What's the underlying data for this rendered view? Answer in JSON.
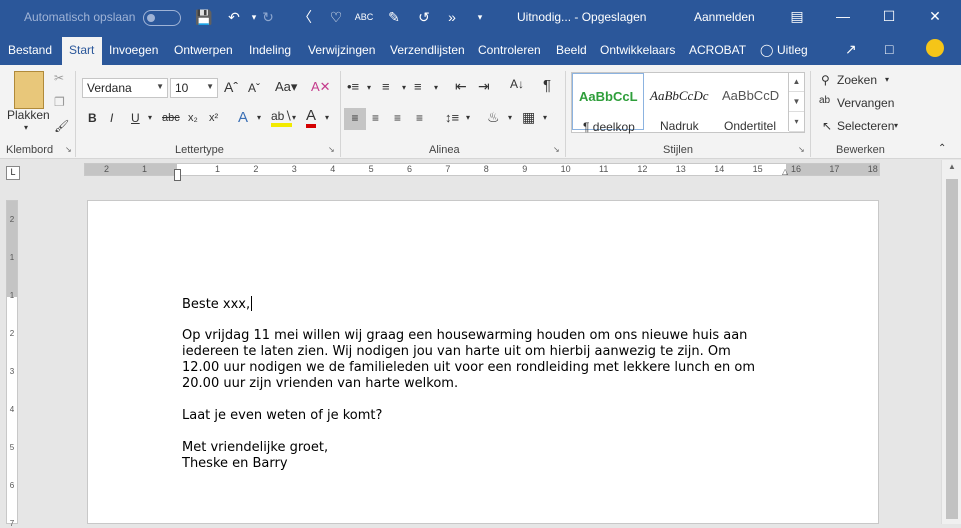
{
  "window": {
    "autosave_label": "Automatisch opslaan",
    "title": "Uitnodig...  -  Opgeslagen",
    "signin": "Aanmelden"
  },
  "tabs": [
    "Bestand",
    "Start",
    "Invoegen",
    "Ontwerpen",
    "Indeling",
    "Verwijzingen",
    "Verzendlijsten",
    "Controleren",
    "Beeld",
    "Ontwikkelaars",
    "ACROBAT"
  ],
  "active_tab": "Start",
  "tellme": "Uitleg",
  "ribbon": {
    "paste_label": "Plakken",
    "font_name": "Verdana",
    "font_size": "10",
    "group_clipboard": "Klembord",
    "group_font": "Lettertype",
    "group_paragraph": "Alinea",
    "group_styles": "Stijlen",
    "group_editing": "Bewerken",
    "styles": [
      {
        "preview": "AaBbCcL",
        "name": "¶ deelkop",
        "color": "#2e9e3a"
      },
      {
        "preview": "AaBbCcDc",
        "name": "Nadruk",
        "color": "#222222"
      },
      {
        "preview": "AaBbCcD",
        "name": "Ondertitel",
        "color": "#555555"
      }
    ],
    "find": "Zoeken",
    "replace": "Vervangen",
    "select": "Selecteren"
  },
  "ruler": {
    "h_numbers": [
      "2",
      "1",
      "1",
      "2",
      "3",
      "4",
      "5",
      "6",
      "7",
      "8",
      "9",
      "10",
      "11",
      "12",
      "13",
      "14",
      "15",
      "16",
      "17",
      "18"
    ],
    "v_numbers": [
      "2",
      "1",
      "1",
      "2",
      "3",
      "4",
      "5",
      "6",
      "7"
    ]
  },
  "document": {
    "lines": [
      "Beste xxx,",
      "",
      "Op vrijdag 11 mei willen wij graag een housewarming houden om ons nieuwe huis aan",
      "iedereen te laten zien. Wij nodigen jou van harte uit om hierbij aanwezig te zijn. Om",
      "12.00 uur nodigen we de familieleden uit voor een rondleiding met lekkere lunch en om",
      "20.00 uur zijn vrienden van harte welkom.",
      "",
      "Laat je even weten of je komt?",
      "",
      "Met vriendelijke groet,",
      "Theske en Barry"
    ]
  },
  "colors": {
    "titlebar": "#2b579a",
    "ribbon": "#f3f3f3",
    "workspace": "#e6e6e6"
  }
}
